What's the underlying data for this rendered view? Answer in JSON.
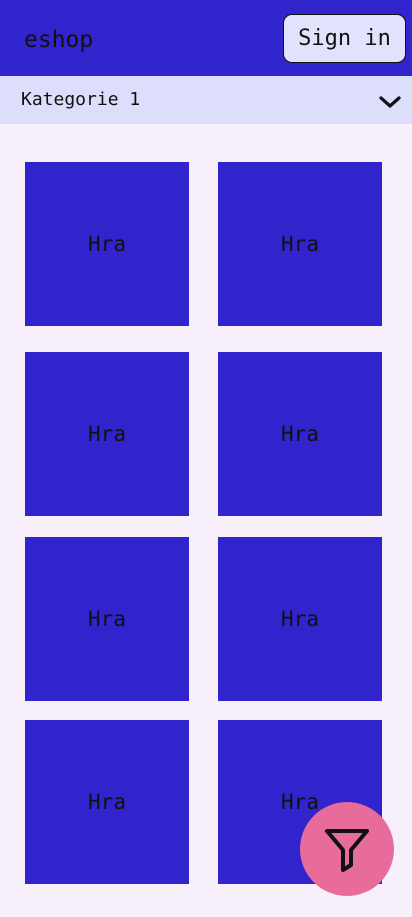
{
  "header": {
    "brand": "eshop",
    "signin_label": "Sign in"
  },
  "category": {
    "selected": "Kategorie 1",
    "icon": "chevron-down-icon"
  },
  "products": [
    {
      "label": "Hra"
    },
    {
      "label": "Hra"
    },
    {
      "label": "Hra"
    },
    {
      "label": "Hra"
    },
    {
      "label": "Hra"
    },
    {
      "label": "Hra"
    },
    {
      "label": "Hra"
    },
    {
      "label": "Hra"
    }
  ],
  "fab": {
    "icon": "filter-icon"
  },
  "colors": {
    "primary": "#3124cc",
    "background": "#f7f0fa",
    "category_bar": "#dcdefc",
    "button_bg": "#e2e2fd",
    "fab": "#e76c9b",
    "text": "#111111"
  }
}
